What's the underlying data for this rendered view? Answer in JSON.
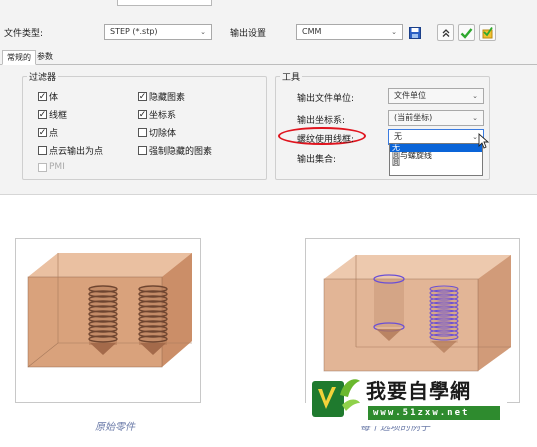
{
  "dialog": {
    "file_type_label": "文件类型:",
    "file_type_value": "STEP (*.stp)",
    "output_settings_label": "输出设置",
    "output_settings_value": "CMM"
  },
  "tabs": [
    {
      "label": "常规的",
      "active": true
    },
    {
      "label": "参数",
      "active": false
    }
  ],
  "filter_group": {
    "title": "过滤器",
    "items": [
      {
        "label": "体",
        "checked": true
      },
      {
        "label": "隐藏图素",
        "checked": true
      },
      {
        "label": "线框",
        "checked": true
      },
      {
        "label": "坐标系",
        "checked": true
      },
      {
        "label": "点",
        "checked": true
      },
      {
        "label": "切除体",
        "checked": false
      },
      {
        "label": "点云输出为点",
        "checked": false
      },
      {
        "label": "强制隐藏的图素",
        "checked": false
      },
      {
        "label": "PMI",
        "checked": false,
        "disabled": true
      }
    ]
  },
  "tools_group": {
    "title": "工具",
    "output_unit_label": "输出文件单位:",
    "output_unit_value": "文件单位",
    "output_coord_label": "输出坐标系:",
    "output_coord_value": "(当前坐标)",
    "thread_wire_label": "螺纹使用线框:",
    "thread_wire_value": "无",
    "output_set_label": "输出集合:",
    "thread_options": [
      "无",
      "圆与螺旋线",
      "圆"
    ],
    "selected_option": "无"
  },
  "captions": {
    "left": "原始零件",
    "right": "每个选项的例子"
  },
  "watermark": {
    "title": "我要自學網",
    "url": "www.51zxw.net"
  },
  "colors": {
    "accent_blue": "#0a64d8",
    "highlight_ring": "#e0141e",
    "confirm_green": "#2ea82e",
    "part_fill": "#d9a27c",
    "thread_wire": "#6a4fd6"
  }
}
